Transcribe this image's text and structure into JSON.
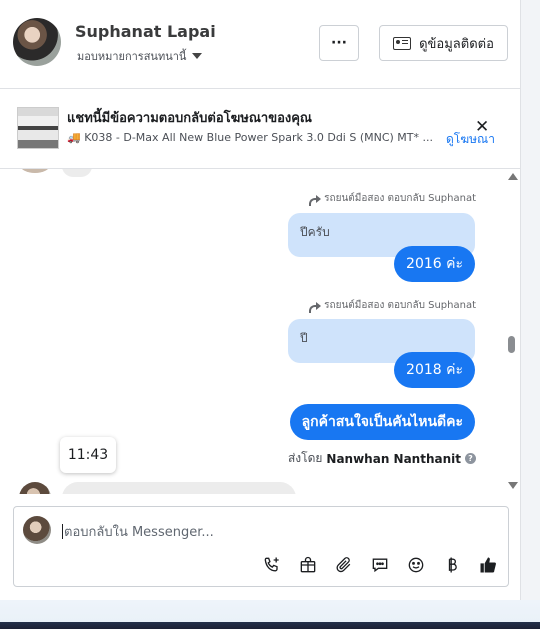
{
  "header": {
    "user_name": "Suphanat Lapai",
    "assigned_label": "มอบหมายการสนทนานี้",
    "more_label": "···",
    "contact_label": "ดูข้อมูลติดต่อ"
  },
  "ad": {
    "title": "แชทนี้มีข้อความตอบกลับต่อโฆษณาของคุณ",
    "subtitle": "🚚 K038 - D-Max All New Blue Power Spark 3.0 Ddi S (MNC) MT* ...",
    "link_label": "ดูโฆษณา",
    "close_label": "✕"
  },
  "messages": [
    {
      "reply_note": "รถยนต์มือสอง ตอบกลับ Suphanat",
      "quoted": "ปีครับ",
      "bubble": "2016 ค่ะ"
    },
    {
      "reply_note": "รถยนต์มือสอง ตอบกลับ Suphanat",
      "quoted": "ปี",
      "bubble": "2018 ค่ะ"
    }
  ],
  "last_message": "ลูกค้าสนใจเป็นคันไหนดีคะ",
  "sent_by": {
    "prefix": "ส่งโดย",
    "name": "Nanwhan Nanthanit",
    "help": "?"
  },
  "timestamp_tooltip": "11:43",
  "composer": {
    "placeholder": "ตอบกลับใน Messenger..."
  },
  "icons": [
    "phone-plus-icon",
    "shopping-bag-icon",
    "paperclip-icon",
    "message-bubble-icon",
    "emoji-icon",
    "baht-icon",
    "thumbs-up-icon"
  ]
}
